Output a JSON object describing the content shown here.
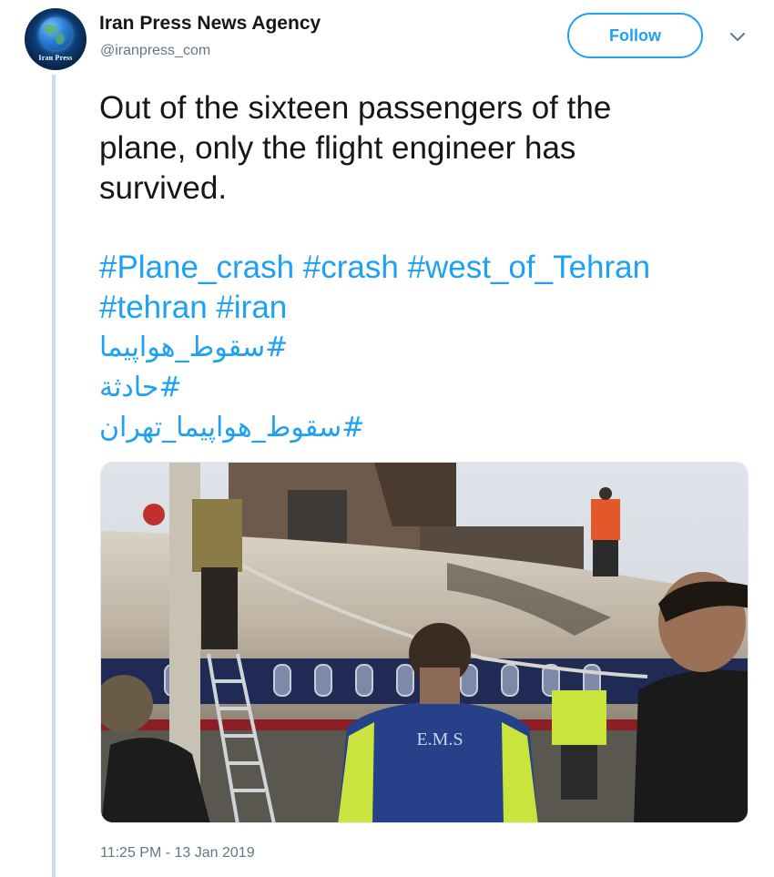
{
  "author": {
    "name": "Iran Press News Agency",
    "handle": "@iranpress_com",
    "avatar_text": "Iran Press"
  },
  "follow_label": "Follow",
  "tweet": {
    "lines": [
      "Out of the sixteen passengers of the",
      "plane, only the flight engineer has",
      "survived."
    ],
    "hashtag_lines": [
      "#Plane_crash  #crash #west_of_Tehran",
      "#tehran #iran",
      "#سقوط_هواپیما",
      "#حادثة",
      "#سقوط_هواپیما_تهران"
    ]
  },
  "media": {
    "vest_text": "E.M.S"
  },
  "timestamp": "11:25 PM - 13 Jan 2019",
  "colors": {
    "accent": "#1da1f2",
    "text": "#14171a",
    "secondary": "#657786",
    "thread_line": "#c5e2f3"
  },
  "icons": {
    "menu": "chevron-down-icon",
    "avatar": "globe-logo"
  }
}
